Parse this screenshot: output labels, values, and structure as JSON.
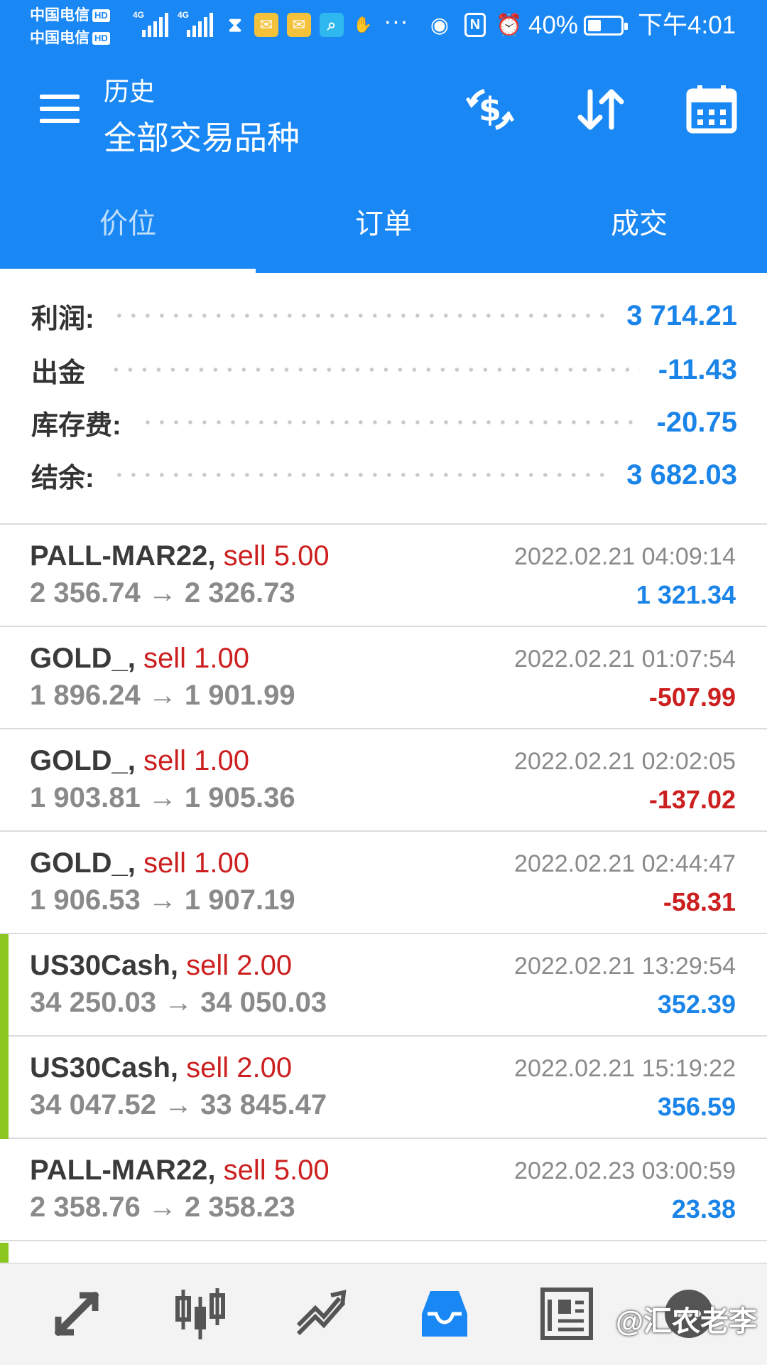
{
  "status_bar": {
    "carrier1": "中国电信",
    "carrier2": "中国电信",
    "hd": "HD",
    "network": "4G",
    "battery": "40%",
    "time": "下午4:01",
    "more": "···"
  },
  "toolbar": {
    "subtitle": "历史",
    "title": "全部交易品种"
  },
  "tabs": [
    {
      "label": "价位",
      "active": true
    },
    {
      "label": "订单",
      "active": false
    },
    {
      "label": "成交",
      "active": false
    }
  ],
  "summary": {
    "profit_label": "利润:",
    "profit_value": "3 714.21",
    "withdrawal_label": "出金",
    "withdrawal_value": "-11.43",
    "swap_label": "库存费:",
    "swap_value": "-20.75",
    "balance_label": "结余:",
    "balance_value": "3 682.03"
  },
  "deals": [
    {
      "symbol": "PALL-MAR22,",
      "side": "sell 5.00",
      "prices": "2 356.74 → 2 326.73",
      "time": "2022.02.21 04:09:14",
      "profit": "1 321.34",
      "positive": true,
      "marker": false
    },
    {
      "symbol": "GOLD_,",
      "side": "sell 1.00",
      "prices": "1 896.24 → 1 901.99",
      "time": "2022.02.21 01:07:54",
      "profit": "-507.99",
      "positive": false,
      "marker": false
    },
    {
      "symbol": "GOLD_,",
      "side": "sell 1.00",
      "prices": "1 903.81 → 1 905.36",
      "time": "2022.02.21 02:02:05",
      "profit": "-137.02",
      "positive": false,
      "marker": false
    },
    {
      "symbol": "GOLD_,",
      "side": "sell 1.00",
      "prices": "1 906.53 → 1 907.19",
      "time": "2022.02.21 02:44:47",
      "profit": "-58.31",
      "positive": false,
      "marker": false
    },
    {
      "symbol": "US30Cash,",
      "side": "sell 2.00",
      "prices": "34 250.03 → 34 050.03",
      "time": "2022.02.21 13:29:54",
      "profit": "352.39",
      "positive": true,
      "marker": true
    },
    {
      "symbol": "US30Cash,",
      "side": "sell 2.00",
      "prices": "34 047.52 → 33 845.47",
      "time": "2022.02.21 15:19:22",
      "profit": "356.59",
      "positive": true,
      "marker": true
    },
    {
      "symbol": "PALL-MAR22,",
      "side": "sell 5.00",
      "prices": "2 358.76 → 2 358.23",
      "time": "2022.02.23 03:00:59",
      "profit": "23.38",
      "positive": true,
      "marker": false
    }
  ],
  "bottom_nav": {
    "items": [
      "quotes-icon",
      "chart-icon",
      "trade-icon",
      "history-icon",
      "news-icon",
      "chat-icon"
    ],
    "active": "history-icon"
  },
  "watermark": "@汇农老李",
  "colors": {
    "primary": "#1a88f4",
    "positive": "#1a84e8",
    "negative": "#cc1f1f",
    "marker": "#8cc620"
  }
}
